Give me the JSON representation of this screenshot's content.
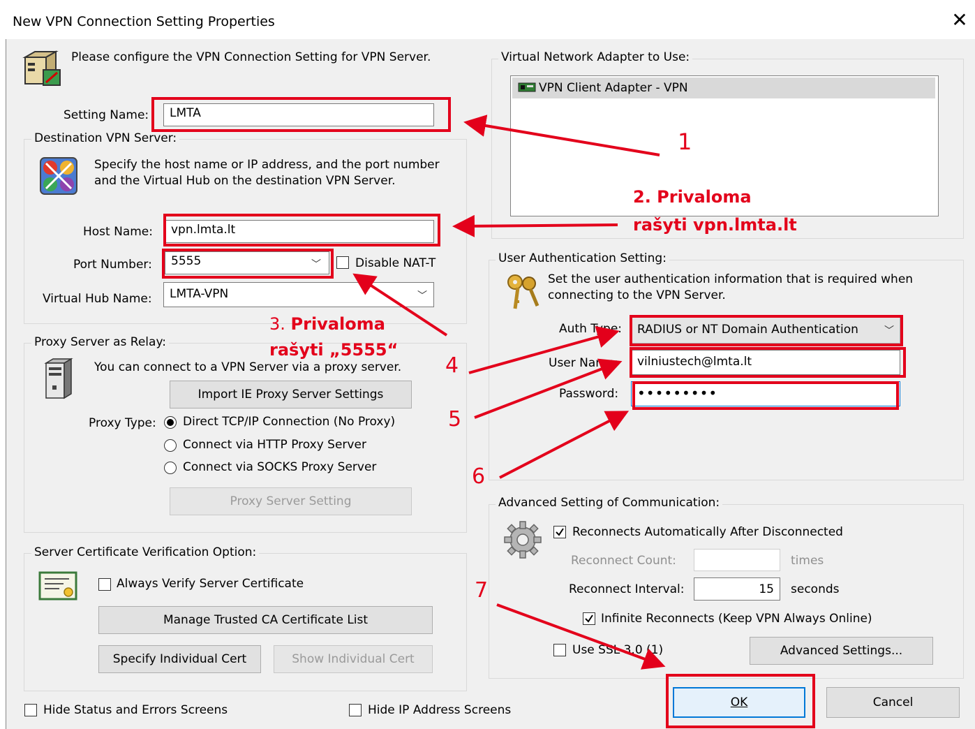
{
  "window": {
    "title": "New VPN Connection Setting Properties"
  },
  "intro": "Please configure the VPN Connection Setting for VPN Server.",
  "setting_name": {
    "label": "Setting Name:",
    "value": "LMTA"
  },
  "destination": {
    "group_label": "Destination VPN Server:",
    "description_line1": "Specify the host name or IP address, and the port number",
    "description_line2": "and the Virtual Hub on the destination VPN Server.",
    "host_label": "Host Name:",
    "host_value": "vpn.lmta.lt",
    "port_label": "Port Number:",
    "port_value": "5555",
    "nat_label": "Disable NAT-T",
    "hub_label": "Virtual Hub Name:",
    "hub_value": "LMTA-VPN"
  },
  "proxy": {
    "group_label": "Proxy Server as Relay:",
    "description": "You can connect to a VPN Server via a proxy server.",
    "import_button": "Import IE Proxy Server Settings",
    "type_label": "Proxy Type:",
    "options": [
      "Direct TCP/IP Connection (No Proxy)",
      "Connect via HTTP Proxy Server",
      "Connect via SOCKS Proxy Server"
    ],
    "selected_option": "Direct TCP/IP Connection (No Proxy)",
    "setting_button": "Proxy Server Setting"
  },
  "certificate": {
    "group_label": "Server Certificate Verification Option:",
    "always_verify": "Always Verify Server Certificate",
    "manage_button": "Manage Trusted CA Certificate List",
    "specify_button": "Specify Individual Cert",
    "show_button": "Show Individual Cert"
  },
  "footer": {
    "hide_status": "Hide Status and Errors Screens",
    "hide_ip": "Hide IP Address Screens",
    "ok": "OK",
    "cancel": "Cancel"
  },
  "adapter": {
    "group_label": "Virtual Network Adapter to Use:",
    "items": [
      "VPN Client Adapter - VPN"
    ]
  },
  "auth": {
    "group_label": "User Authentication Setting:",
    "description_line1": "Set the user authentication information that is required when",
    "description_line2": "connecting to the VPN Server.",
    "type_label": "Auth Type:",
    "type_value": "RADIUS or NT Domain Authentication",
    "user_label": "User Name:",
    "user_value": "vilniustech@lmta.lt",
    "password_label": "Password:",
    "password_value": "•••••••••"
  },
  "advanced": {
    "group_label": "Advanced Setting of Communication:",
    "reconnect_auto": "Reconnects Automatically After Disconnected",
    "reconnect_count_label": "Reconnect Count:",
    "reconnect_count_value": "",
    "times_label": "times",
    "reconnect_interval_label": "Reconnect Interval:",
    "reconnect_interval_value": "15",
    "seconds_label": "seconds",
    "infinite_label": "Infinite Reconnects (Keep VPN Always Online)",
    "ssl_label": "Use SSL 3.0 (1)",
    "advanced_button": "Advanced Settings..."
  },
  "annotations": {
    "n1": "1",
    "n2_line1": "2. Privaloma",
    "n2_line2": "rašyti vpn.lmta.lt",
    "n3_prefix": "3. ",
    "n3_line1": "Privaloma",
    "n3_line2": "rašyti „5555“",
    "n4": "4",
    "n5": "5",
    "n6": "6",
    "n7": "7"
  },
  "colors": {
    "annotation_red": "#e3001b",
    "dialog_bg": "#f0f0f0",
    "ok_border": "#0078d7"
  }
}
